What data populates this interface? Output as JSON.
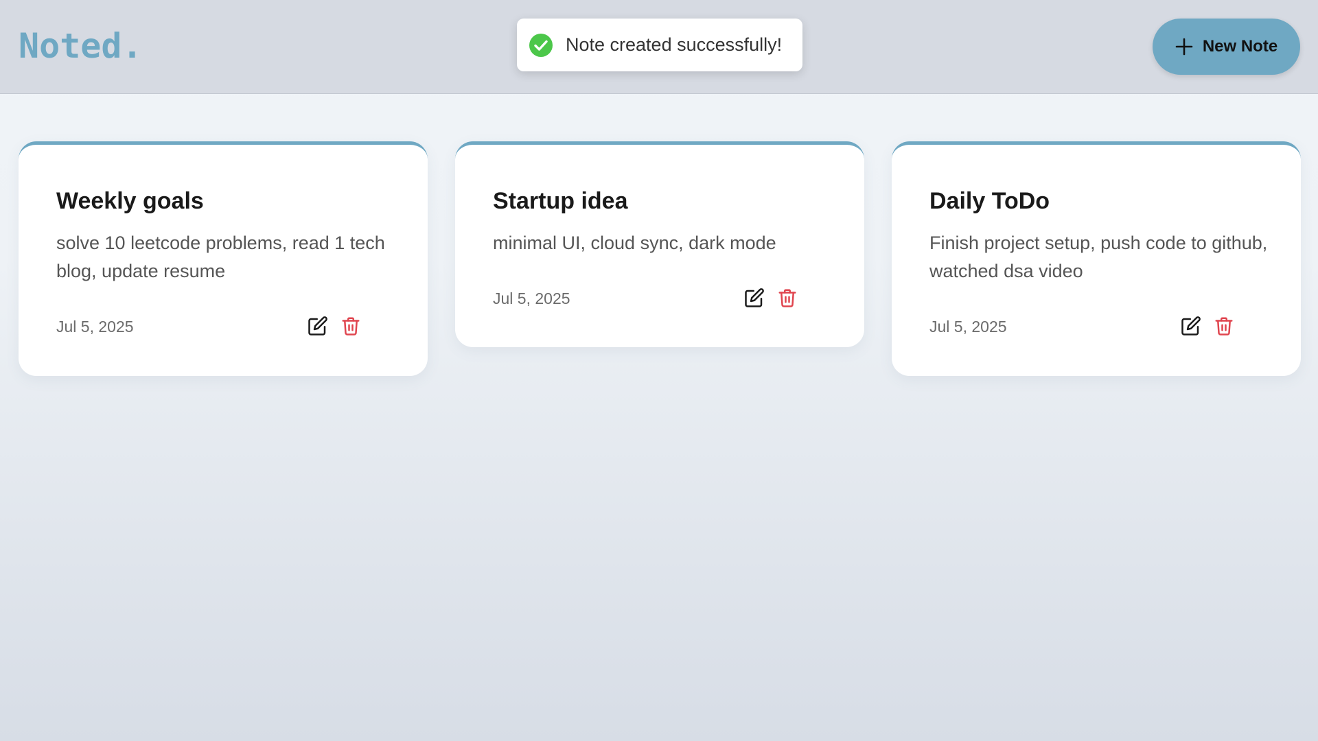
{
  "app": {
    "logo": "Noted."
  },
  "header": {
    "new_note_label": "New Note",
    "new_note_icon": "plus-icon"
  },
  "toast": {
    "message": "Note created successfully!",
    "icon": "check-circle-icon",
    "color": "#4cc74a"
  },
  "colors": {
    "accent": "#6fa8c3",
    "delete": "#e0454f",
    "navbar": "#d6dae2"
  },
  "notes": [
    {
      "title": "Weekly goals",
      "body": "solve 10 leetcode problems, read 1 tech blog, update resume",
      "date": "Jul 5, 2025"
    },
    {
      "title": "Startup idea",
      "body": "minimal UI, cloud sync, dark mode",
      "date": "Jul 5, 2025"
    },
    {
      "title": "Daily ToDo",
      "body": "Finish project setup, push code to github, watched dsa video",
      "date": "Jul 5, 2025"
    }
  ]
}
